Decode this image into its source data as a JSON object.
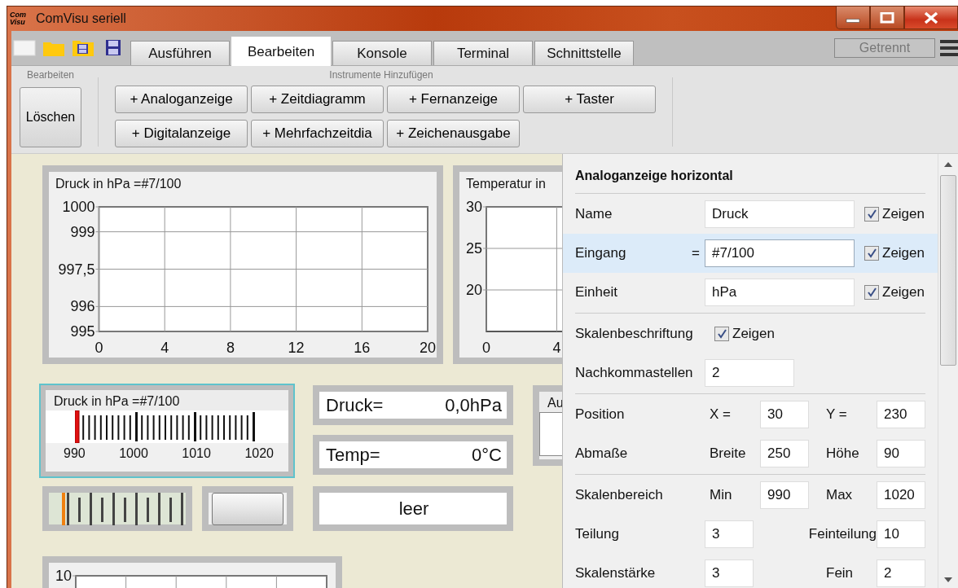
{
  "window": {
    "title": "ComVisu seriell",
    "logo_text": [
      "Com",
      "Visu"
    ]
  },
  "tabs": [
    {
      "label": "Ausführen",
      "selected": false
    },
    {
      "label": "Bearbeiten",
      "selected": true
    },
    {
      "label": "Konsole",
      "selected": false
    },
    {
      "label": "Terminal",
      "selected": false
    },
    {
      "label": "Schnittstelle",
      "selected": false
    }
  ],
  "connection_status": "Getrennt",
  "ribbon": {
    "groups": [
      {
        "title": "Bearbeiten",
        "buttons": [
          "Löschen"
        ]
      },
      {
        "title": "Instrumente Hinzufügen",
        "buttons": [
          "+ Analoganzeige",
          "+ Zeitdiagramm",
          "+ Fernanzeige",
          "+ Taster",
          "+ Digitalanzeige",
          "+ Mehrfachzeitdia",
          "+ Zeichenausgabe"
        ]
      }
    ]
  },
  "canvas": {
    "instruments": [
      {
        "kind": "chart",
        "title": "Druck in hPa =#7/100",
        "chart_data": {
          "type": "line",
          "grid": true,
          "xlim": [
            0,
            20
          ],
          "ylim": [
            995,
            1000
          ],
          "xticks": [
            0,
            4,
            8,
            12,
            16,
            20
          ],
          "yticks": [
            995,
            996,
            {
              "value": 997.5,
              "label": "997,5"
            },
            999,
            1000
          ]
        }
      },
      {
        "kind": "chart",
        "title": "Temperatur in",
        "chart_data": {
          "type": "line",
          "grid": true,
          "xlim": [
            0,
            20
          ],
          "ylim": [
            15,
            30
          ],
          "xticks": [
            0,
            4
          ],
          "yticks": [
            20,
            25,
            30
          ]
        }
      },
      {
        "kind": "analog",
        "title": "Druck in hPa =#7/100",
        "scale_labels": [
          "990",
          "1000",
          "1010",
          "1020"
        ],
        "level": 0,
        "selected": true
      },
      {
        "kind": "display",
        "label": "Druck=",
        "value": "0,0hPa"
      },
      {
        "kind": "display",
        "label": "Temp=",
        "value": "0°C"
      },
      {
        "kind": "text",
        "value": "leer"
      },
      {
        "kind": "frame",
        "title": "Au"
      },
      {
        "kind": "bar",
        "level": 0
      },
      {
        "kind": "button"
      },
      {
        "kind": "chart",
        "y_labels": [
          "10"
        ]
      }
    ]
  },
  "properties": {
    "title": "Analoganzeige horizontal",
    "groups": [
      [
        {
          "kind": "field_check",
          "label": "Name",
          "value": "Druck",
          "check": {
            "label": "Zeigen",
            "checked": true
          },
          "selected": false
        },
        {
          "kind": "field_check",
          "label": "Eingang",
          "prefix": "=",
          "value": "#7/100",
          "check": {
            "label": "Zeigen",
            "checked": true
          },
          "selected": true
        },
        {
          "kind": "field_check",
          "label": "Einheit",
          "value": "hPa",
          "check": {
            "label": "Zeigen",
            "checked": true
          },
          "selected": false
        }
      ],
      [
        {
          "kind": "check",
          "label": "Skalenbeschriftung",
          "check": {
            "label": "Zeigen",
            "checked": true
          }
        },
        {
          "kind": "field",
          "label": "Nachkommastellen",
          "value": "2"
        }
      ],
      [
        {
          "kind": "pair",
          "label": "Position",
          "fields": [
            {
              "label": "X =",
              "value": "30"
            },
            {
              "label": "Y =",
              "value": "230"
            }
          ]
        },
        {
          "kind": "pair",
          "label": "Abmaße",
          "fields": [
            {
              "label": "Breite",
              "value": "250"
            },
            {
              "label": "Höhe",
              "value": "90"
            }
          ]
        }
      ],
      [
        {
          "kind": "pair",
          "label": "Skalenbereich",
          "fields": [
            {
              "label": "Min",
              "value": "990"
            },
            {
              "label": "Max",
              "value": "1020"
            }
          ]
        },
        {
          "kind": "pair",
          "label": "Teilung",
          "fields": [
            {
              "value": "3"
            },
            {
              "label": "Feinteilung",
              "value": "10"
            }
          ]
        },
        {
          "kind": "pair",
          "label": "Skalenstärke",
          "fields": [
            {
              "value": "3"
            },
            {
              "label": "Fein",
              "value": "2"
            }
          ]
        }
      ]
    ]
  }
}
